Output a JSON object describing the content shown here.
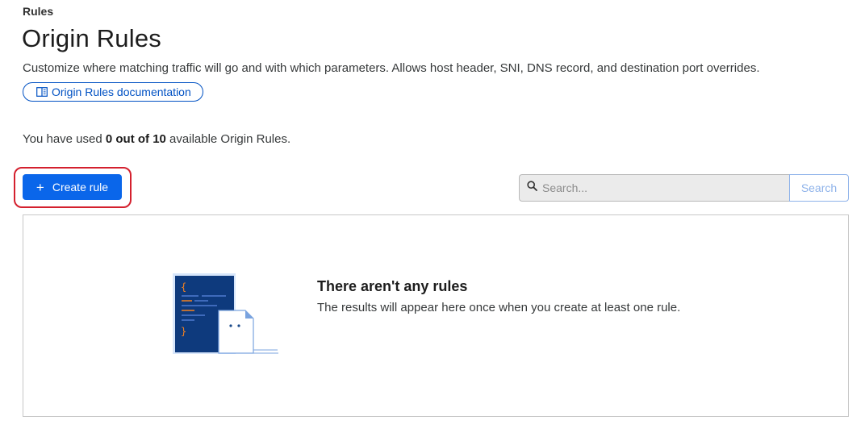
{
  "breadcrumb": "Rules",
  "page_title": "Origin Rules",
  "description": "Customize where matching traffic will go and with which parameters. Allows host header, SNI, DNS record, and destination port overrides.",
  "doc_link": {
    "label": "Origin Rules documentation",
    "icon": "book-icon"
  },
  "usage": {
    "prefix": "You have used ",
    "count": "0 out of 10",
    "suffix": " available Origin Rules."
  },
  "toolbar": {
    "create_label": "Create rule",
    "create_icon": "plus-icon"
  },
  "search": {
    "placeholder": "Search...",
    "value": "",
    "button_label": "Search"
  },
  "empty_state": {
    "title": "There aren't any rules",
    "subtitle": "The results will appear here once when you create at least one rule.",
    "illustration": "code-document-illustration"
  },
  "colors": {
    "accent": "#0a66ea",
    "link": "#0051c3",
    "highlight": "#d4202e",
    "illustration_navy": "#0e3a7d"
  }
}
